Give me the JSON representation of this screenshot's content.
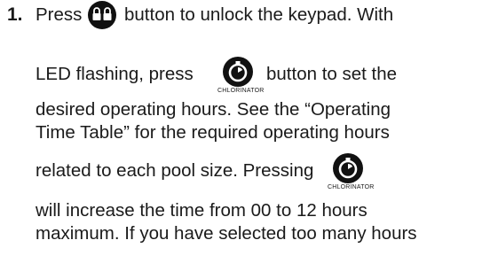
{
  "step": {
    "number": "1.",
    "line1": {
      "before": "Press",
      "after": "button to unlock the keypad. With"
    },
    "line2": {
      "before": "LED flashing, press",
      "after": "button to set the"
    },
    "line3": "desired operating hours. See the “Operating",
    "line4": "Time Table” for the required operating hours",
    "line5": "related to each pool size. Pressing",
    "line6": "will increase the time from 00 to 12 hours",
    "line7": "maximum. If you have selected too many hours"
  },
  "icons": {
    "lock": {
      "name": "keypad-lock-button-icon"
    },
    "chlorinator": {
      "name": "chlorinator-timer-button-icon",
      "label": "CHLORINATOR"
    }
  }
}
